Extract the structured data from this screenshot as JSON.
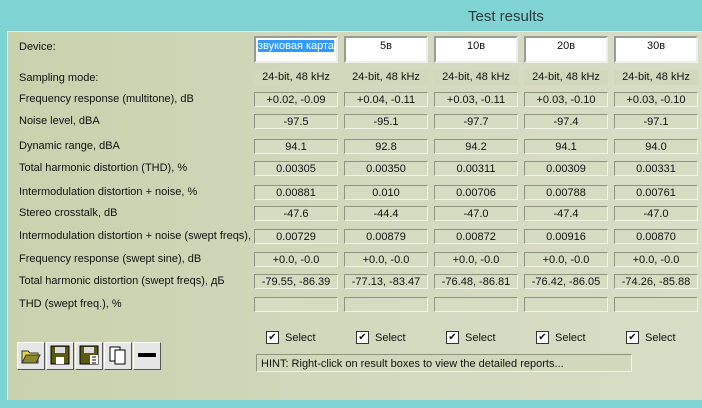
{
  "window": {
    "title": "Test results"
  },
  "labels": {
    "device": "Device:",
    "sampling": "Sampling mode:"
  },
  "devices": [
    "звуковая карта",
    "5в",
    "10в",
    "20в",
    "30в"
  ],
  "sampling": [
    "24-bit, 48 kHz",
    "24-bit, 48 kHz",
    "24-bit, 48 kHz",
    "24-bit, 48 kHz",
    "24-bit, 48 kHz"
  ],
  "rows": [
    {
      "label": "Frequency response (multitone), dB",
      "values": [
        "+0.02, -0.09",
        "+0.04, -0.11",
        "+0.03, -0.11",
        "+0.03, -0.10",
        "+0.03, -0.10"
      ]
    },
    {
      "label": "Noise level, dBA",
      "values": [
        "-97.5",
        "-95.1",
        "-97.7",
        "-97.4",
        "-97.1"
      ]
    },
    {
      "label": "Dynamic range, dBA",
      "values": [
        "94.1",
        "92.8",
        "94.2",
        "94.1",
        "94.0"
      ]
    },
    {
      "label": "Total harmonic distortion (THD), %",
      "values": [
        "0.00305",
        "0.00350",
        "0.00311",
        "0.00309",
        "0.00331"
      ]
    },
    {
      "label": "Intermodulation distortion + noise, %",
      "values": [
        "0.00881",
        "0.010",
        "0.00706",
        "0.00788",
        "0.00761"
      ]
    },
    {
      "label": "Stereo crosstalk, dB",
      "values": [
        "-47.6",
        "-44.4",
        "-47.0",
        "-47.4",
        "-47.0"
      ]
    },
    {
      "label": "Intermodulation distortion + noise (swept freqs), %",
      "values": [
        "0.00729",
        "0.00879",
        "0.00872",
        "0.00916",
        "0.00870"
      ]
    },
    {
      "label": "Frequency response (swept sine), dB",
      "values": [
        "+0.0, -0.0",
        "+0.0, -0.0",
        "+0.0, -0.0",
        "+0.0, -0.0",
        "+0.0, -0.0"
      ]
    },
    {
      "label": "Total harmonic distortion (swept freqs), дБ",
      "values": [
        "-79.55, -86.39",
        "-77.13, -83.47",
        "-76.48, -86.81",
        "-76.42, -86.05",
        "-74.26, -85.88"
      ]
    },
    {
      "label": "THD (swept freq.), %",
      "values": [
        "",
        "",
        "",
        "",
        ""
      ]
    }
  ],
  "select_label": "Select",
  "hint": "HINT: Right-click on result boxes to view the detailed reports...",
  "toolbar": [
    "open-icon",
    "save-icon",
    "save-report-icon",
    "copy-icon",
    "remove-icon"
  ]
}
